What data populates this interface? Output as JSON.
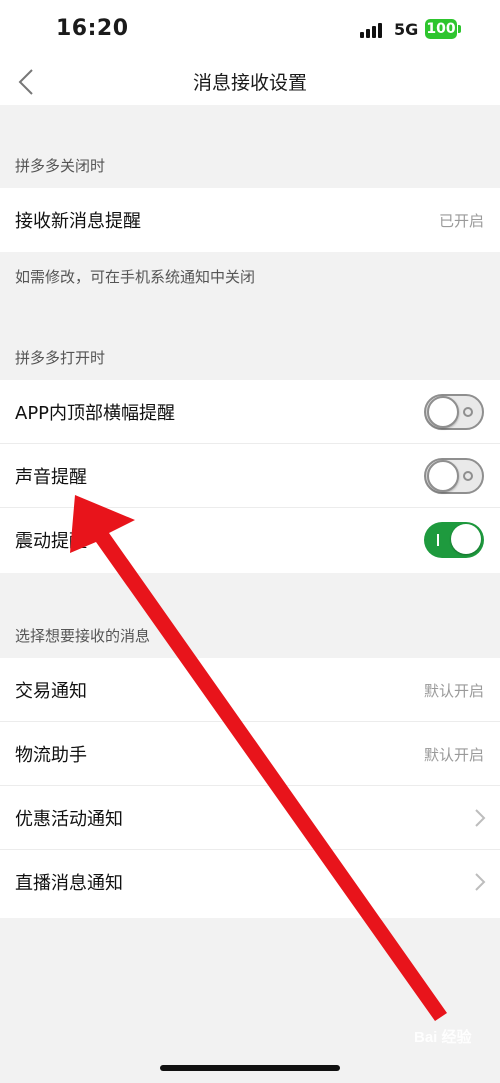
{
  "status_bar": {
    "time": "16:20",
    "network": "5G",
    "battery": "100",
    "battery_color": "#2ec52e"
  },
  "nav": {
    "title": "消息接收设置",
    "back_icon": "chevron-left-icon"
  },
  "section_closed": {
    "header": "拼多多关闭时",
    "rows": [
      {
        "label": "接收新消息提醒",
        "value": "已开启"
      }
    ],
    "note": "如需修改，可在手机系统通知中关闭"
  },
  "section_open": {
    "header": "拼多多打开时",
    "rows": [
      {
        "label": "APP内顶部横幅提醒",
        "toggle": "off"
      },
      {
        "label": "声音提醒",
        "toggle": "off"
      },
      {
        "label": "震动提醒",
        "toggle": "on"
      }
    ]
  },
  "section_types": {
    "header": "选择想要接收的消息",
    "rows": [
      {
        "label": "交易通知",
        "value": "默认开启"
      },
      {
        "label": "物流助手",
        "value": "默认开启"
      },
      {
        "label": "优惠活动通知",
        "icon": "chevron-right-icon"
      },
      {
        "label": "直播消息通知",
        "icon": "chevron-right-icon"
      }
    ]
  },
  "colors": {
    "toggle_on": "#1e9a3e",
    "annotation_arrow": "#e8141b"
  },
  "watermark": "Bai 经验"
}
